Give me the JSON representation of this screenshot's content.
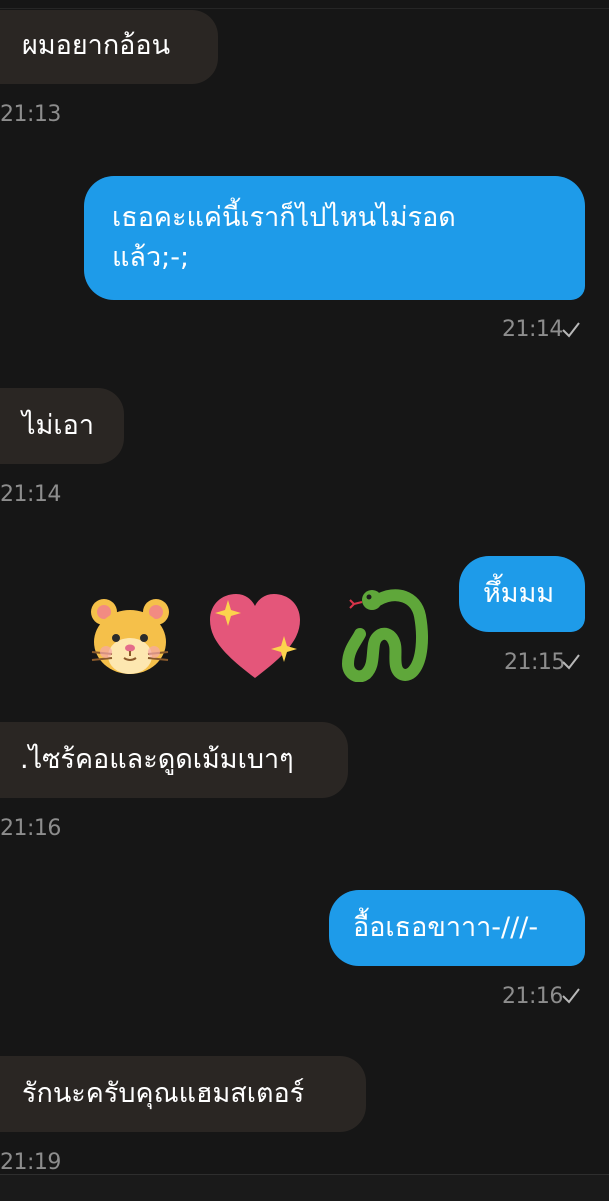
{
  "messages": [
    {
      "direction": "in",
      "text": "ผมอยากอ้อน",
      "time": "21:13"
    },
    {
      "direction": "out",
      "lines": [
        "เธอคะแค่นี้เราก็ไปไหนไม่รอด",
        "แล้ว;-;"
      ],
      "time": "21:14",
      "status": "sent"
    },
    {
      "direction": "in",
      "text": "ไม่เอา",
      "time": "21:14"
    },
    {
      "direction": "out",
      "text": "หึ้มมม",
      "time": "21:15",
      "status": "sent",
      "emoji": [
        "hamster-face-icon",
        "sparkling-heart-icon",
        "snake-icon"
      ]
    },
    {
      "direction": "in",
      "text": ".ไซร้คอและดูดเม้มเบาๆ",
      "time": "21:16"
    },
    {
      "direction": "out",
      "text": "อื้อเธอขาาา-///-",
      "time": "21:16",
      "status": "sent"
    },
    {
      "direction": "in",
      "text": "รักนะครับคุณแฮมสเตอร์",
      "time": "21:19"
    }
  ],
  "colors": {
    "background": "#161616",
    "incoming_bubble": "#2a2623",
    "outgoing_bubble": "#1e9be9",
    "timestamp": "#8d8d8d"
  }
}
